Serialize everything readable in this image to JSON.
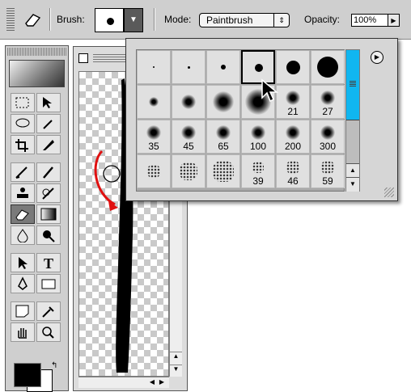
{
  "options_bar": {
    "brush_label": "Brush:",
    "mode_label": "Mode:",
    "mode_value": "Paintbrush",
    "opacity_label": "Opacity:",
    "opacity_value": "100%",
    "current_tool_icon": "eraser-icon"
  },
  "brush_palette": {
    "rows": [
      [
        {
          "size_label": ""
        },
        {
          "size_label": ""
        },
        {
          "size_label": ""
        },
        {
          "size_label": "",
          "selected": true
        },
        {
          "size_label": ""
        },
        {
          "size_label": ""
        }
      ],
      [
        {
          "size_label": ""
        },
        {
          "size_label": ""
        },
        {
          "size_label": ""
        },
        {
          "size_label": ""
        },
        {
          "size_label": "21"
        },
        {
          "size_label": "27"
        }
      ],
      [
        {
          "size_label": "35"
        },
        {
          "size_label": "45"
        },
        {
          "size_label": "65"
        },
        {
          "size_label": "100"
        },
        {
          "size_label": "200"
        },
        {
          "size_label": "300"
        }
      ],
      [
        {
          "size_label": ""
        },
        {
          "size_label": ""
        },
        {
          "size_label": ""
        },
        {
          "size_label": "39"
        },
        {
          "size_label": "46"
        },
        {
          "size_label": "59"
        }
      ]
    ],
    "scroll_thumb_color": "#10b6f0"
  },
  "toolbox": {
    "tools": [
      "marquee-icon",
      "move-icon",
      "lasso-icon",
      "magic-wand-icon",
      "crop-icon",
      "slice-icon",
      "healing-brush-icon",
      "brush-icon",
      "stamp-icon",
      "history-brush-icon",
      "eraser-icon",
      "gradient-icon",
      "blur-icon",
      "burn-icon",
      "path-select-icon",
      "type-icon",
      "pen-icon",
      "shape-icon",
      "notes-icon",
      "eyedropper-icon",
      "hand-icon",
      "zoom-icon"
    ],
    "selected_tool": "eraser-icon",
    "text_tool_glyph": "T"
  },
  "annotation": {
    "arrow_color": "#e01010"
  }
}
